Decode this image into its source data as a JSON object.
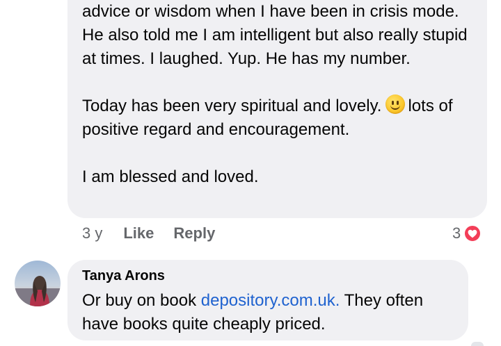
{
  "comment_one": {
    "paragraph_1": "advice or wisdom when I have been in crisis mode.  He also told me I am intelligent but also really stupid at times.  I laughed. Yup.  He has my number.",
    "paragraph_2_before_emoji": "Today has been very spiritual and lovely.",
    "paragraph_2_emoji": "smiling-face-icon",
    "paragraph_2_after_emoji": "lots of positive regard and encouragement.",
    "paragraph_3": "I am blessed and loved.",
    "timestamp": "3 y",
    "like_label": "Like",
    "reply_label": "Reply",
    "reaction_count": "3",
    "reaction_icon": "heart-icon",
    "reaction_color": "#f33e58"
  },
  "comment_two": {
    "author": "Tanya Arons",
    "text_before_link": "Or buy on book ",
    "link_text": "depository.com.uk.",
    "text_after_link": " They often have books quite cheaply priced.",
    "avatar_icon": "profile-photo-avatar",
    "link_color": "#1f62cf"
  },
  "colors": {
    "bubble": "#f0f0f3",
    "secondary_text": "#65676b",
    "primary_text": "#050505"
  }
}
